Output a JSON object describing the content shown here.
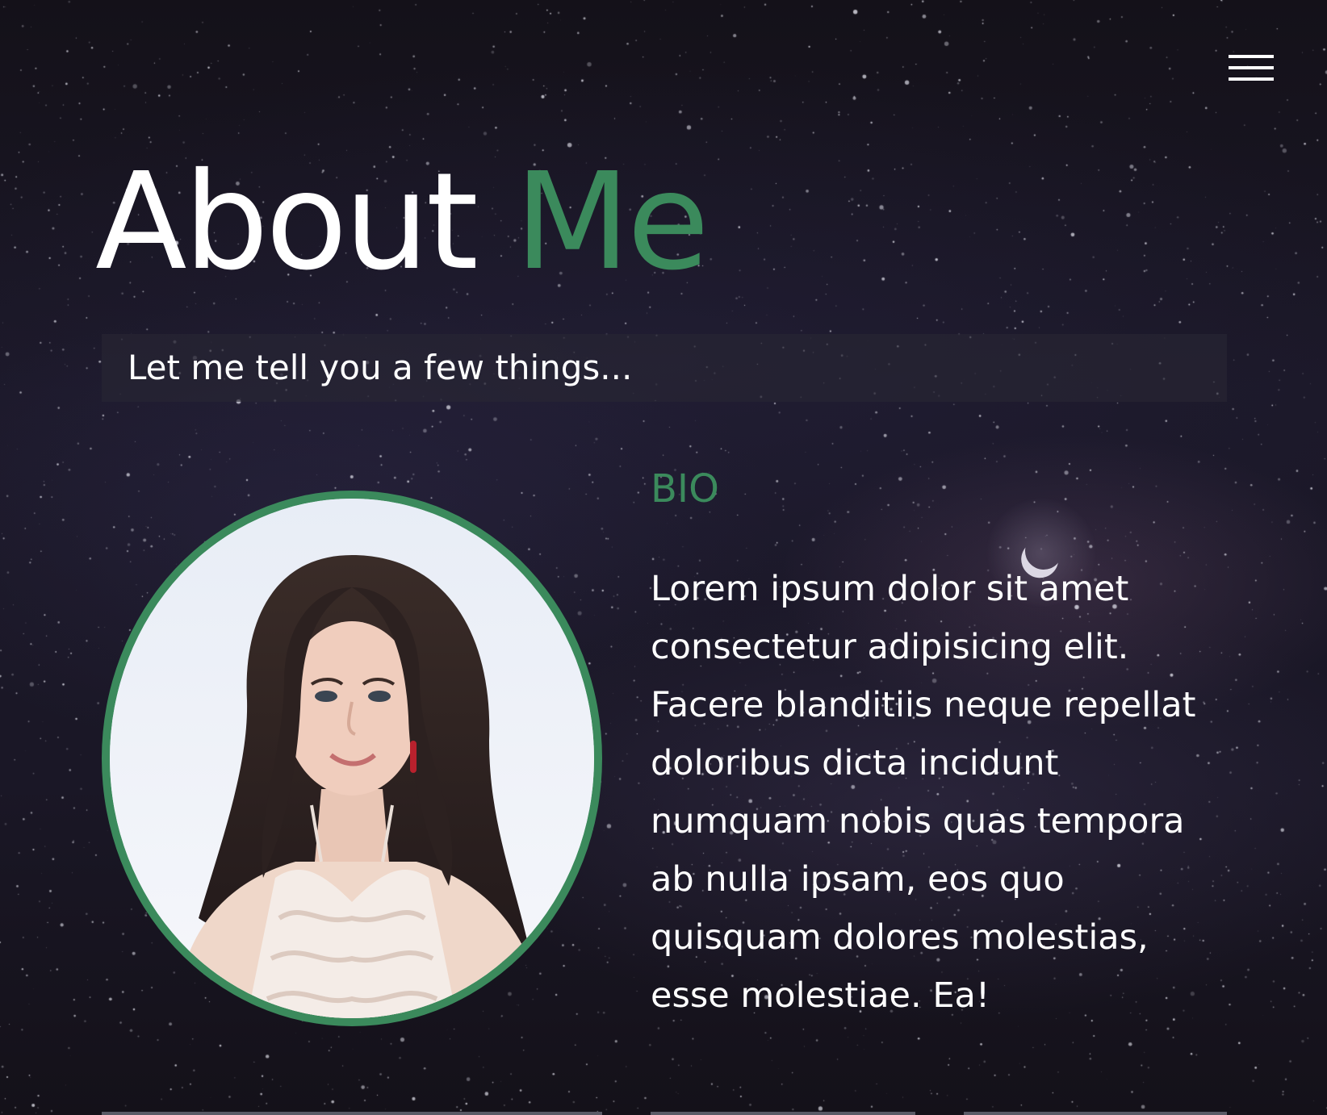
{
  "header": {
    "menu_icon": "hamburger-menu-icon"
  },
  "hero": {
    "title_plain": "About",
    "title_accent": "Me",
    "subtitle": "Let me tell you a few things..."
  },
  "profile": {
    "photo_icon": "profile-photo"
  },
  "bio": {
    "heading": "BIO",
    "text": "Lorem ipsum dolor sit amet consectetur adipisicing elit. Facere blanditiis neque repellat doloribus dicta incidunt numquam nobis quas tempora ab nulla ipsam, eos quo quisquam dolores molestias, esse molestiae. Ea!"
  },
  "theme": {
    "accent": "#3b8a5c",
    "background": "#141019",
    "text": "#ffffff"
  }
}
